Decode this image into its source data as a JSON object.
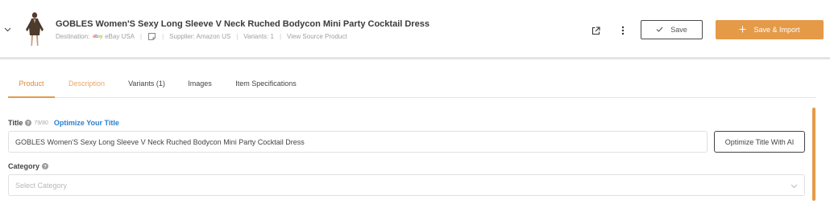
{
  "product": {
    "title": "GOBLES Women'S Sexy Long Sleeve V Neck Ruched Bodycon Mini Party Cocktail Dress",
    "destination_label": "Destination:",
    "destination_value": "eBay USA",
    "supplier": "Supplier: Amazon US",
    "variants": "Variants: 1",
    "view_source": "View Source Product"
  },
  "icons": {
    "expand": "chevron-down-icon",
    "ebay": "ebay-logo-icon",
    "note": "note-icon",
    "external": "external-link-icon",
    "more": "more-vertical-icon",
    "check": "check-icon",
    "plus": "plus-icon",
    "help": "help-circle-icon"
  },
  "actions": {
    "save_label": "Save",
    "import_label": "Save & Import"
  },
  "tabs": [
    {
      "label": "Product",
      "active": true
    },
    {
      "label": "Description",
      "active": false
    },
    {
      "label": "Variants (1)",
      "active": false
    },
    {
      "label": "Images",
      "active": false
    },
    {
      "label": "Item Specifications",
      "active": false
    }
  ],
  "title_field": {
    "label": "Title",
    "count": "79/80",
    "optimize_link": "Optimize Your Title",
    "value": "GOBLES Women'S Sexy Long Sleeve V Neck Ruched Bodycon Mini Party Cocktail Dress",
    "ai_button": "Optimize Title With AI"
  },
  "category_field": {
    "label": "Category",
    "placeholder": "Select Category"
  },
  "colors": {
    "accent": "#e59a48",
    "link": "#2b7fd0"
  }
}
